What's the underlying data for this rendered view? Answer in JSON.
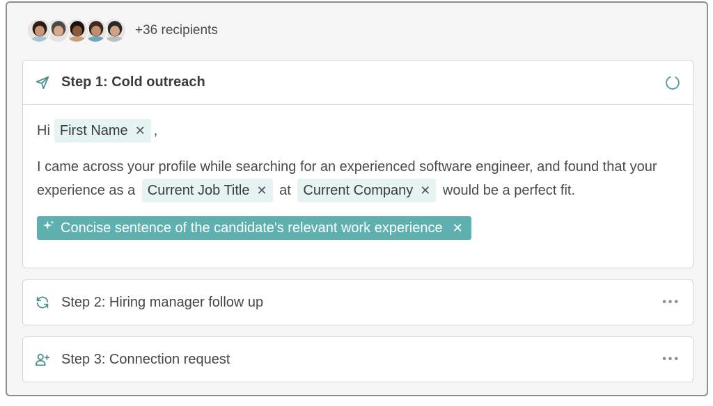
{
  "recipients": {
    "count_label": "+36 recipients",
    "avatars": [
      {
        "skin": "#c99678",
        "hair": "#2b1d16",
        "shirt": "#a9c4d6"
      },
      {
        "skin": "#d9a98a",
        "hair": "#4a4a4a",
        "shirt": "#e3e3e3"
      },
      {
        "skin": "#8a5a3c",
        "hair": "#1c120c",
        "shirt": "#c8a07c"
      },
      {
        "skin": "#c08d6e",
        "hair": "#3a2a22",
        "shirt": "#6fa4bf"
      },
      {
        "skin": "#d1a488",
        "hair": "#2a2a2a",
        "shirt": "#bcbcbc"
      }
    ]
  },
  "steps": [
    {
      "title": "Step 1: Cold outreach",
      "icon": "send-icon",
      "status": "loading-spinner",
      "content": {
        "greeting_prefix": "Hi",
        "greeting_chip": "First Name",
        "greeting_suffix": ",",
        "para_text_1": "I came across your profile while searching for an experienced software engineer, and found that your experience as a",
        "chip_job_title": "Current Job Title",
        "para_text_2": "at",
        "chip_company": "Current Company",
        "para_text_3": "would be a perfect fit.",
        "ai_chip": "Concise sentence of the candidate's relevant work experience"
      }
    },
    {
      "title": "Step 2: Hiring manager follow up",
      "icon": "refresh-icon",
      "more": "•••"
    },
    {
      "title": "Step 3: Connection request",
      "icon": "add-user-icon",
      "more": "•••"
    }
  ],
  "chip_remove_glyph": "✕",
  "colors": {
    "accent": "#5fb0b0",
    "chip_bg": "#e5f3f3",
    "icon": "#4f8f91"
  }
}
